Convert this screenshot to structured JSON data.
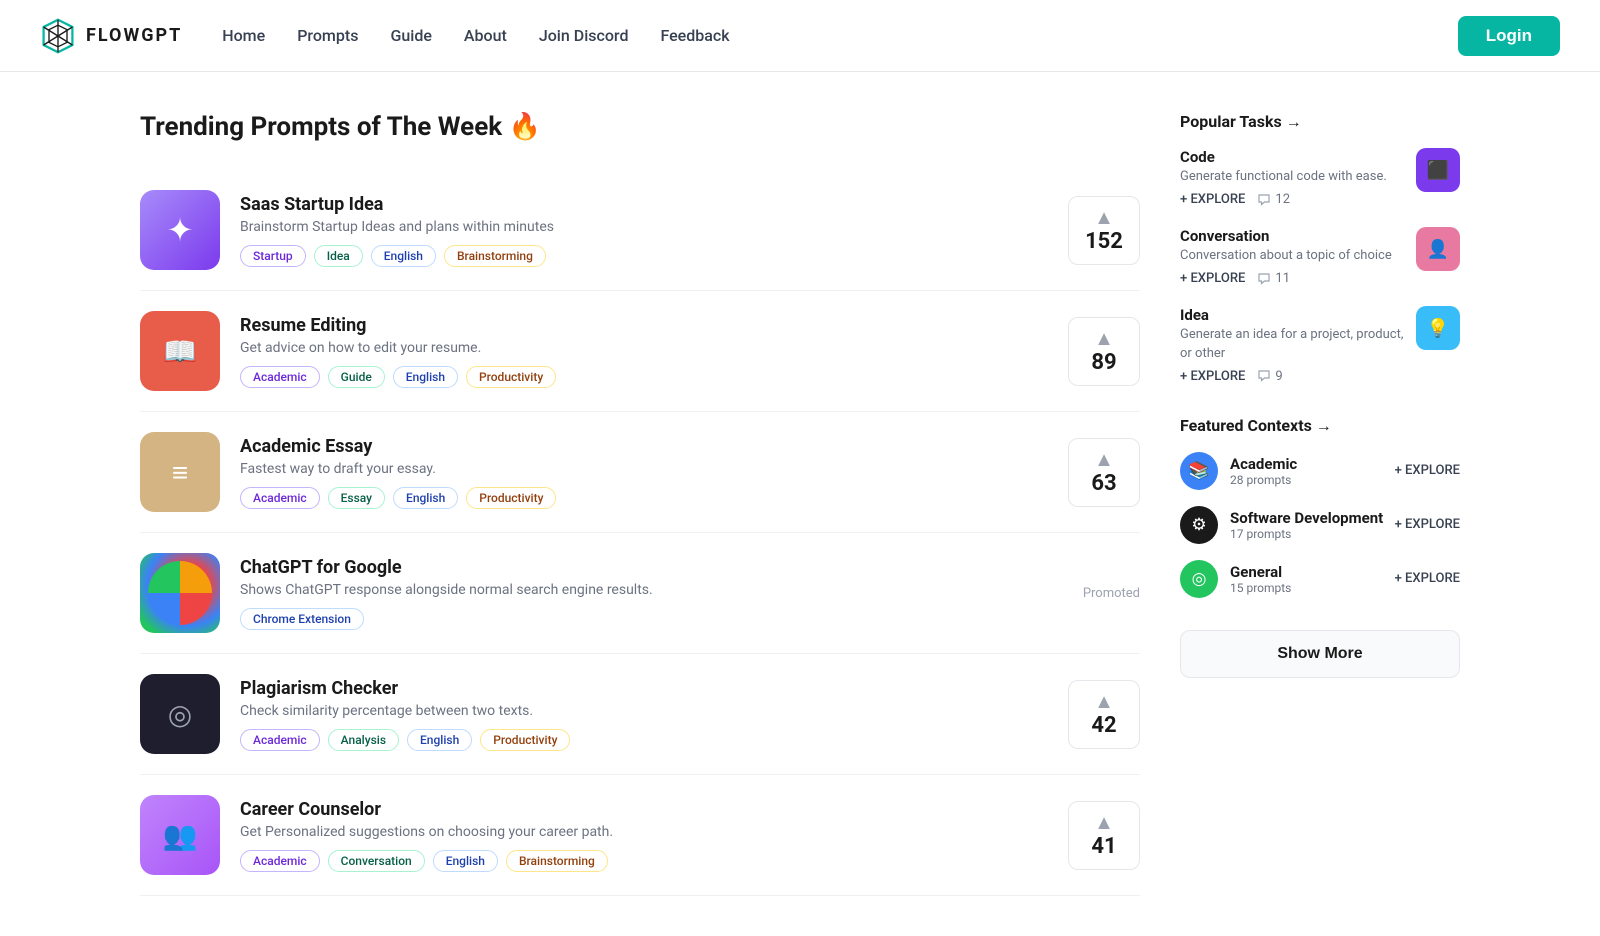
{
  "navbar": {
    "logo_text": "FLOWGPT",
    "links": [
      {
        "label": "Home",
        "name": "home"
      },
      {
        "label": "Prompts",
        "name": "prompts"
      },
      {
        "label": "Guide",
        "name": "guide"
      },
      {
        "label": "About",
        "name": "about"
      },
      {
        "label": "Join Discord",
        "name": "join-discord"
      },
      {
        "label": "Feedback",
        "name": "feedback"
      }
    ],
    "login_label": "Login"
  },
  "main": {
    "page_title": "Trending Prompts of The Week 🔥",
    "prompts": [
      {
        "id": "saas-startup",
        "title": "Saas Startup Idea",
        "desc": "Brainstorm Startup Ideas and plans within minutes",
        "tags": [
          "Startup",
          "Idea",
          "English",
          "Brainstorming"
        ],
        "tag_types": [
          "startup",
          "idea",
          "english",
          "brainstorming"
        ],
        "votes": 152,
        "thumb_type": "purple",
        "thumb_icon": "✦",
        "promoted": false
      },
      {
        "id": "resume-editing",
        "title": "Resume Editing",
        "desc": "Get advice on how to edit your resume.",
        "tags": [
          "Academic",
          "Guide",
          "English",
          "Productivity"
        ],
        "tag_types": [
          "academic",
          "guide",
          "english",
          "productivity"
        ],
        "votes": 89,
        "thumb_type": "red",
        "thumb_icon": "📖",
        "promoted": false
      },
      {
        "id": "academic-essay",
        "title": "Academic Essay",
        "desc": "Fastest way to draft your essay.",
        "tags": [
          "Academic",
          "Essay",
          "English",
          "Productivity"
        ],
        "tag_types": [
          "academic",
          "essay",
          "english",
          "productivity"
        ],
        "votes": 63,
        "thumb_type": "tan",
        "thumb_icon": "≡",
        "promoted": false
      },
      {
        "id": "chatgpt-google",
        "title": "ChatGPT for Google",
        "desc": "Shows ChatGPT response alongside normal search engine results.",
        "tags": [
          "Chrome Extension"
        ],
        "tag_types": [
          "chrome"
        ],
        "votes": null,
        "thumb_type": "chatgpt",
        "thumb_icon": "",
        "promoted": true,
        "promoted_label": "Promoted"
      },
      {
        "id": "plagiarism-checker",
        "title": "Plagiarism Checker",
        "desc": "Check similarity percentage between two texts.",
        "tags": [
          "Academic",
          "Analysis",
          "English",
          "Productivity"
        ],
        "tag_types": [
          "academic",
          "analysis",
          "english",
          "productivity"
        ],
        "votes": 42,
        "thumb_type": "dark",
        "thumb_icon": "◎",
        "promoted": false
      },
      {
        "id": "career-counselor",
        "title": "Career Counselor",
        "desc": "Get Personalized suggestions on choosing your career path.",
        "tags": [
          "Academic",
          "Conversation",
          "English",
          "Brainstorming"
        ],
        "tag_types": [
          "academic",
          "conversation",
          "english",
          "brainstorming"
        ],
        "votes": 41,
        "thumb_type": "pink",
        "thumb_icon": "👥",
        "promoted": false
      }
    ]
  },
  "sidebar": {
    "popular_tasks_title": "Popular Tasks →",
    "tasks": [
      {
        "title": "Code",
        "desc": "Generate functional code with ease.",
        "explore_label": "+ EXPLORE",
        "comments": 12,
        "thumb_type": "code",
        "thumb_icon": "⬛"
      },
      {
        "title": "Conversation",
        "desc": "Conversation about a topic of choice",
        "explore_label": "+ EXPLORE",
        "comments": 11,
        "thumb_type": "conv",
        "thumb_icon": "👤"
      },
      {
        "title": "Idea",
        "desc": "Generate an idea for a project, product, or other",
        "explore_label": "+ EXPLORE",
        "comments": 9,
        "thumb_type": "ideab",
        "thumb_icon": "💡"
      }
    ],
    "featured_contexts_title": "Featured Contexts →",
    "contexts": [
      {
        "title": "Academic",
        "count": "28 prompts",
        "explore_label": "+ EXPLORE",
        "icon_type": "academic",
        "icon": "📚"
      },
      {
        "title": "Software Development",
        "count": "17 prompts",
        "explore_label": "+ EXPLORE",
        "icon_type": "software",
        "icon": "⚙"
      },
      {
        "title": "General",
        "count": "15 prompts",
        "explore_label": "+ EXPLORE",
        "icon_type": "general",
        "icon": "◎"
      }
    ],
    "show_more_label": "Show More"
  }
}
